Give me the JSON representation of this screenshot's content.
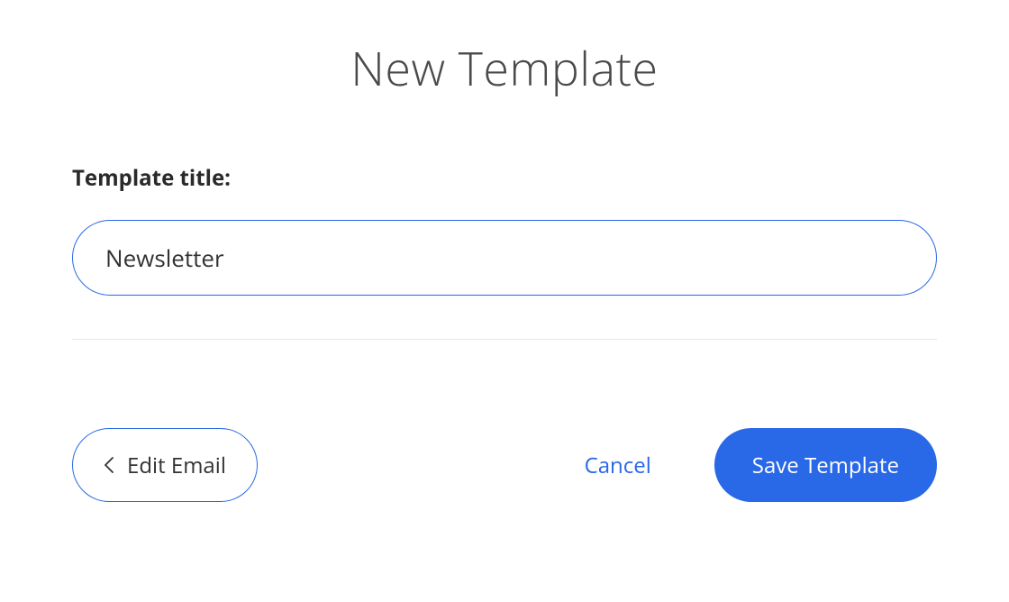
{
  "header": {
    "title": "New Template"
  },
  "form": {
    "title_label": "Template title:",
    "title_value": "Newsletter"
  },
  "actions": {
    "edit_email_label": "Edit Email",
    "cancel_label": "Cancel",
    "save_label": "Save Template"
  },
  "colors": {
    "primary": "#2968e6",
    "text_dark": "#2a2a2a",
    "text_muted": "#4a4a4a"
  }
}
